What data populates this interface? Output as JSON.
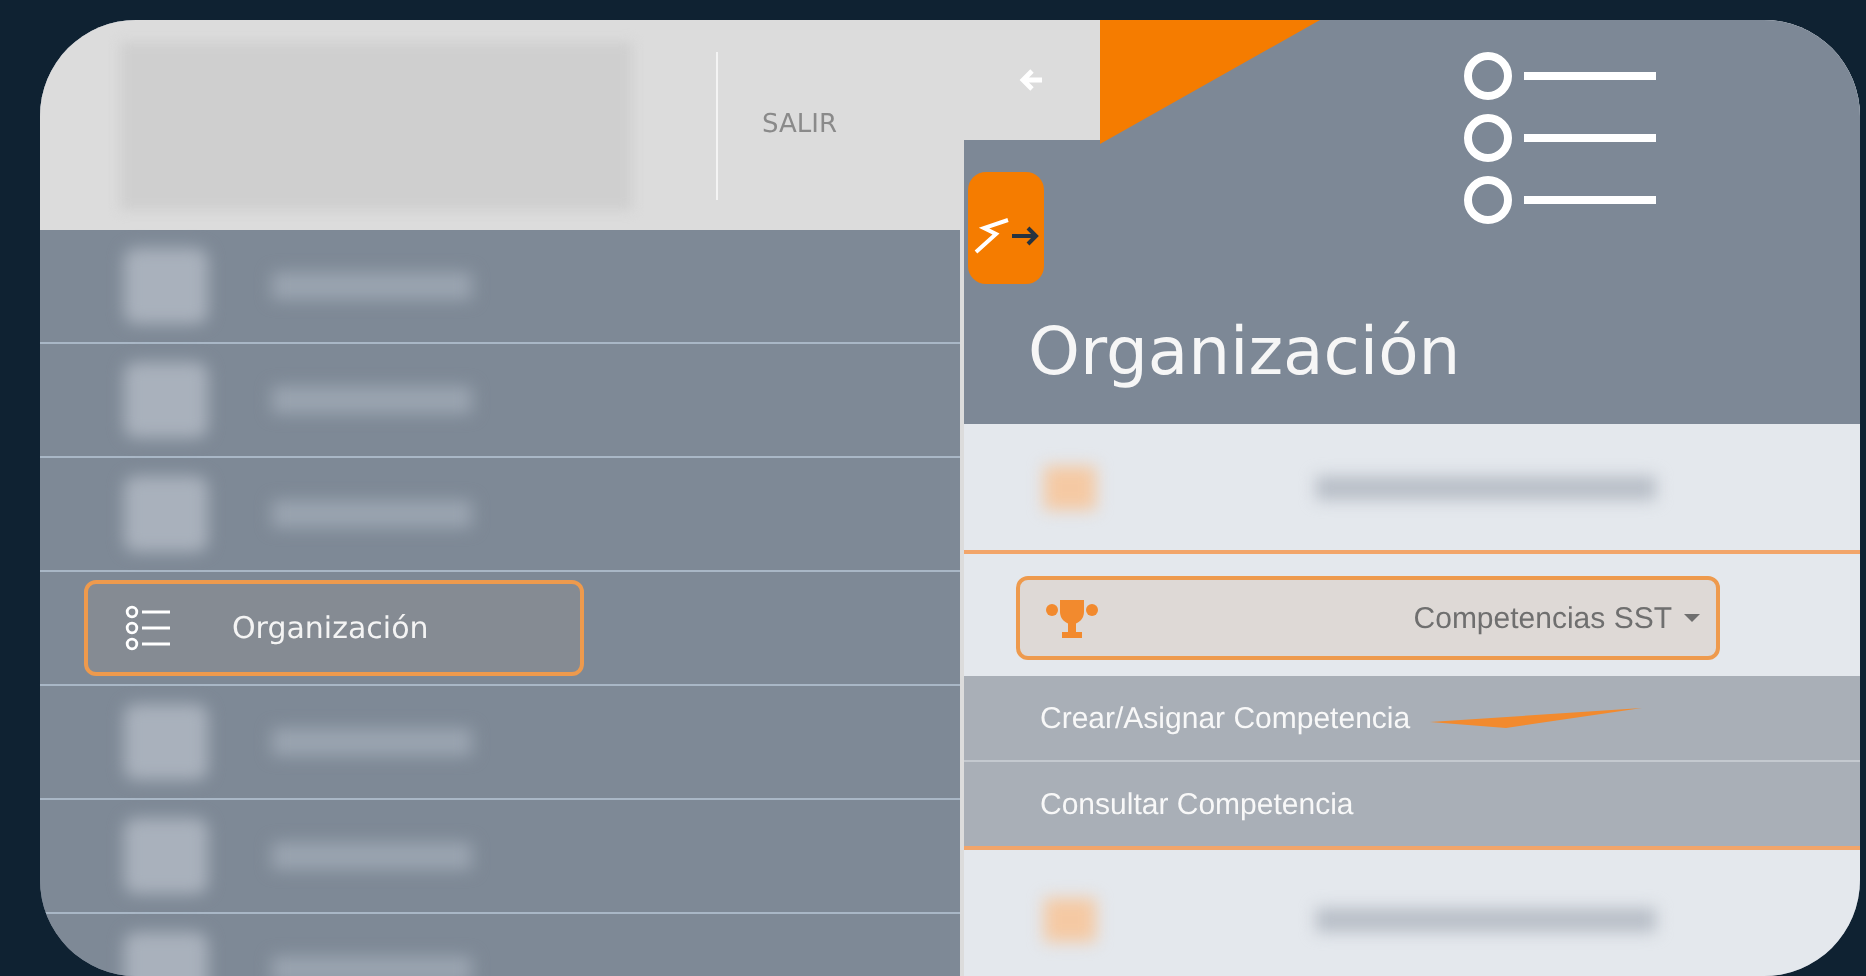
{
  "header": {
    "exit_label": "SALIR"
  },
  "sidebar": {
    "items": [
      {
        "kind": "blurred",
        "selected": false
      },
      {
        "kind": "blurred",
        "selected": false
      },
      {
        "kind": "blurred",
        "selected": false
      },
      {
        "kind": "entry",
        "label": "Organización",
        "selected": true
      },
      {
        "kind": "blurred",
        "selected": false
      },
      {
        "kind": "blurred",
        "selected": false
      },
      {
        "kind": "blurred",
        "selected": false
      }
    ]
  },
  "panel": {
    "title": "Organización",
    "dropdown": {
      "label": "Competencias SST",
      "expanded": true
    },
    "submenu": [
      {
        "label": "Crear/Asignar Competencia"
      },
      {
        "label": "Consultar Competencia"
      }
    ]
  }
}
